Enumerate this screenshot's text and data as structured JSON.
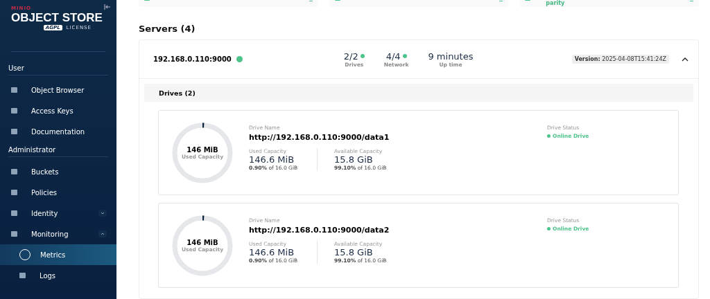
{
  "sidebar": {
    "brand": "MINIO",
    "product": "OBJECT STORE",
    "license_badge": "AGPL",
    "license": "LICENSE",
    "sections": [
      {
        "title": "User",
        "items": [
          {
            "label": "Object Browser",
            "selected": false
          },
          {
            "label": "Access Keys",
            "selected": false
          },
          {
            "label": "Documentation",
            "selected": false
          }
        ]
      },
      {
        "title": "Administrator",
        "items": [
          {
            "label": "Buckets",
            "selected": false
          },
          {
            "label": "Policies",
            "selected": false
          },
          {
            "label": "Identity",
            "selected": false,
            "expanded": false
          },
          {
            "label": "Monitoring",
            "selected": false,
            "expanded": true,
            "children": [
              {
                "label": "Metrics",
                "selected": true
              },
              {
                "label": "Logs",
                "selected": false
              }
            ]
          }
        ]
      }
    ]
  },
  "top_cards_label": "parity",
  "servers_title": "Servers (4)",
  "server": {
    "address": "192.168.0.110:9000",
    "online": true,
    "expanded": true,
    "stats": [
      {
        "value": "2/2",
        "label": "Drives",
        "dot": true
      },
      {
        "value": "4/4",
        "label": "Network",
        "dot": true
      },
      {
        "value": "9 minutes",
        "label": "Up time",
        "dot": false
      }
    ],
    "version_label": "Version:",
    "version": "2025-04-08T15:41:24Z",
    "drives_title": "Drives (2)",
    "drives": [
      {
        "ring_value": "146 MiB",
        "ring_label": "Used Capacity",
        "level": 0.009,
        "name_label": "Drive Name",
        "name": "http://192.168.0.110:9000/data1",
        "used_label": "Used Capacity",
        "used": "146.6 MiB",
        "used_pct": "0.90%",
        "used_of": "of 16.0 GiB",
        "avail_label": "Available Capacity",
        "avail": "15.8 GiB",
        "avail_pct": "99.10%",
        "avail_of": "of 16.0 GiB",
        "status_label": "Drive Status",
        "status": "Online Drive",
        "online": true
      },
      {
        "ring_value": "146 MiB",
        "ring_label": "Used Capacity",
        "level": 0.009,
        "name_label": "Drive Name",
        "name": "http://192.168.0.110:9000/data2",
        "used_label": "Used Capacity",
        "used": "146.6 MiB",
        "used_pct": "0.90%",
        "used_of": "of 16.0 GiB",
        "avail_label": "Available Capacity",
        "avail": "15.8 GiB",
        "avail_pct": "99.10%",
        "avail_of": "of 16.0 GiB",
        "status_label": "Drive Status",
        "status": "Online Drive",
        "online": true
      }
    ]
  }
}
